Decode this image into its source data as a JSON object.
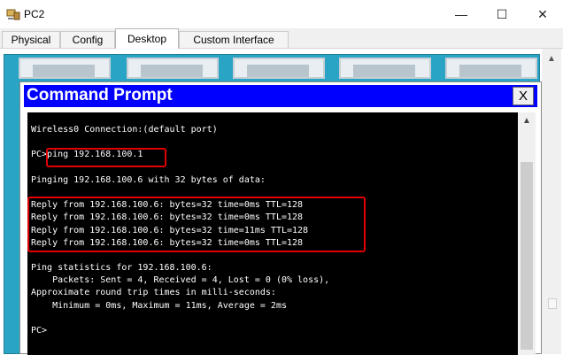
{
  "window": {
    "title": "PC2",
    "minimize_glyph": "—",
    "maximize_glyph": "☐",
    "close_glyph": "✕"
  },
  "tabs": [
    {
      "label": "Physical",
      "active": false
    },
    {
      "label": "Config",
      "active": false
    },
    {
      "label": "Desktop",
      "active": true
    },
    {
      "label": "Custom Interface",
      "active": false
    }
  ],
  "command_prompt": {
    "title": "Command Prompt",
    "close_label": "X",
    "console_lines": [
      "Wireless0 Connection:(default port)",
      "",
      "PC>ping 192.168.100.1",
      "",
      "Pinging 192.168.100.6 with 32 bytes of data:",
      "",
      "Reply from 192.168.100.6: bytes=32 time=0ms TTL=128",
      "Reply from 192.168.100.6: bytes=32 time=0ms TTL=128",
      "Reply from 192.168.100.6: bytes=32 time=11ms TTL=128",
      "Reply from 192.168.100.6: bytes=32 time=0ms TTL=128",
      "",
      "Ping statistics for 192.168.100.6:",
      "    Packets: Sent = 4, Received = 4, Lost = 0 (0% loss),",
      "Approximate round trip times in milli-seconds:",
      "    Minimum = 0ms, Maximum = 11ms, Average = 2ms",
      "",
      "PC>"
    ]
  },
  "colors": {
    "desktop_background": "#2aa4c5",
    "cmd_title_bar": "#0000ff",
    "console_background": "#000000",
    "console_text": "#ffffff",
    "highlight_border": "#e00000"
  },
  "icons": {
    "app": "packet-tracer-pc-icon",
    "scroll_up": "chevron-up-icon"
  }
}
